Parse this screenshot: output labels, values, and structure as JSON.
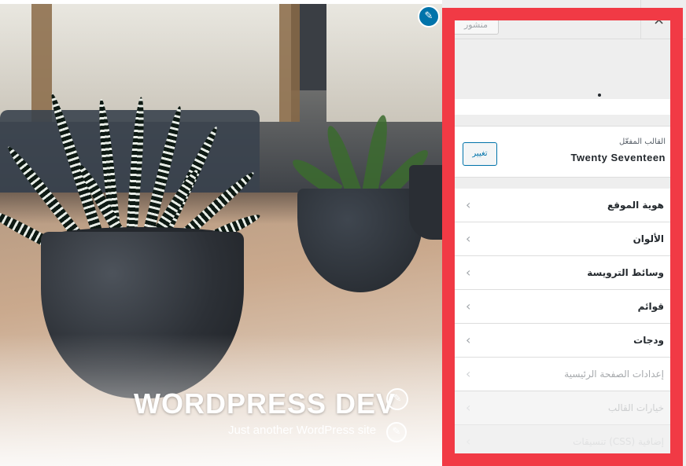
{
  "preview": {
    "site_title": "WORDPRESS DEV",
    "site_tagline": "Just another WordPress site",
    "icons": {
      "edit_header": "pencil-icon",
      "edit_title": "pencil-icon",
      "edit_tagline": "pencil-icon"
    }
  },
  "customizer": {
    "close_symbol": "×",
    "publish_label": "منشور",
    "active_theme_label": "القالب المفعّل",
    "active_theme_name": "Twenty Seventeen",
    "change_theme_button": "تغيير",
    "sections": [
      {
        "label": "هوية الموقع",
        "state": "normal"
      },
      {
        "label": "الألوان",
        "state": "normal"
      },
      {
        "label": "وسائط الترويسة",
        "state": "normal"
      },
      {
        "label": "قوائم",
        "state": "normal"
      },
      {
        "label": "ودجات",
        "state": "normal"
      },
      {
        "label": "إعدادات الصفحة الرئيسية",
        "state": "dim"
      },
      {
        "label": "خيارات القالب",
        "state": "faded"
      },
      {
        "label": "تنسيقات (CSS) إضافية",
        "state": "very-faded"
      }
    ],
    "chevron_icon": "chevron-left-icon"
  },
  "colors": {
    "highlight_border": "#f13a45",
    "accent": "#0073aa"
  }
}
